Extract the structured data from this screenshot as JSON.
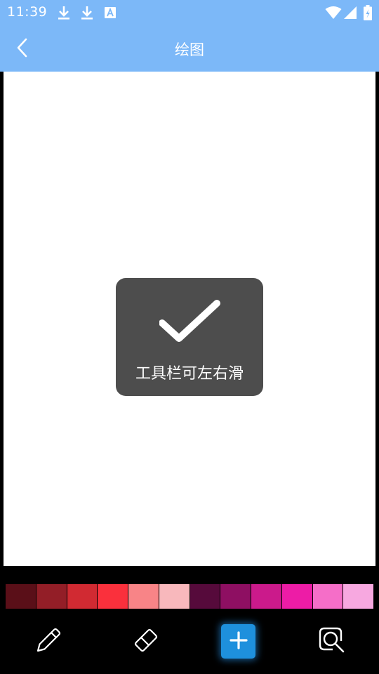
{
  "status_bar": {
    "time": "11:39",
    "left_icons": [
      "download-icon",
      "download-icon",
      "text-notification-icon"
    ],
    "right_icons": [
      "wifi-icon",
      "signal-icon",
      "battery-icon"
    ]
  },
  "app_bar": {
    "title": "绘图",
    "back_icon": "chevron-left-icon",
    "color": "#7cb8f8"
  },
  "canvas": {
    "background": "#ffffff"
  },
  "toast": {
    "icon": "checkmark-icon",
    "message": "工具栏可左右滑",
    "background": "#4d4d4d"
  },
  "palette": {
    "colors": [
      "#5a0f18",
      "#931e27",
      "#d12a32",
      "#fa303c",
      "#f88487",
      "#f8b8bc",
      "#560a3b",
      "#8e0f62",
      "#cb1a8b",
      "#ed1ca6",
      "#f56ec8",
      "#f7a8e0"
    ]
  },
  "toolbar": {
    "tools": [
      "pencil-icon",
      "eraser-icon",
      "plus-icon",
      "zoom-icon"
    ],
    "active_color": "#1e90dd"
  }
}
